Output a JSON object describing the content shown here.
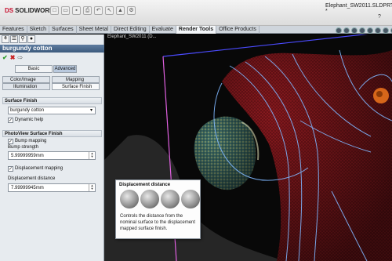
{
  "app": {
    "logo": "SOLIDWORKS",
    "window_title": "Elephant_SW2011.SLDPRT *",
    "help": "?"
  },
  "tabs": [
    "Features",
    "Sketch",
    "Surfaces",
    "Sheet Metal",
    "Direct Editing",
    "Evaluate",
    "Render Tools",
    "Office Products"
  ],
  "active_tab": "Render Tools",
  "panel": {
    "title": "burgundy cotton",
    "actions": {
      "ok": "✔",
      "cancel": "✖",
      "detach": "⇨"
    },
    "mode_buttons": {
      "basic": "Basic",
      "advanced": "Advanced"
    },
    "subtabs": {
      "color_image": "Color/Image",
      "mapping": "Mapping",
      "illumination": "Illumination",
      "surface_finish": "Surface Finish"
    },
    "surface_finish": {
      "heading": "Surface Finish",
      "selected": "burgundy cotton",
      "dynamic_help": "Dynamic help"
    },
    "photoview": {
      "heading": "PhotoView Surface Finish",
      "bump_mapping": "Bump mapping",
      "bump_strength_label": "Bump strength",
      "bump_strength": "5.99999959mm",
      "displacement_mapping": "Displacement mapping",
      "displacement_distance_label": "Displacement distance",
      "displacement_distance": "7.99999945mm"
    }
  },
  "viewport": {
    "tree_label": "Elephant_SW2011 (D..."
  },
  "tooltip": {
    "title": "Displacement distance",
    "text": "Controls the distance from the nominal surface to the displacement mapped surface finish."
  }
}
